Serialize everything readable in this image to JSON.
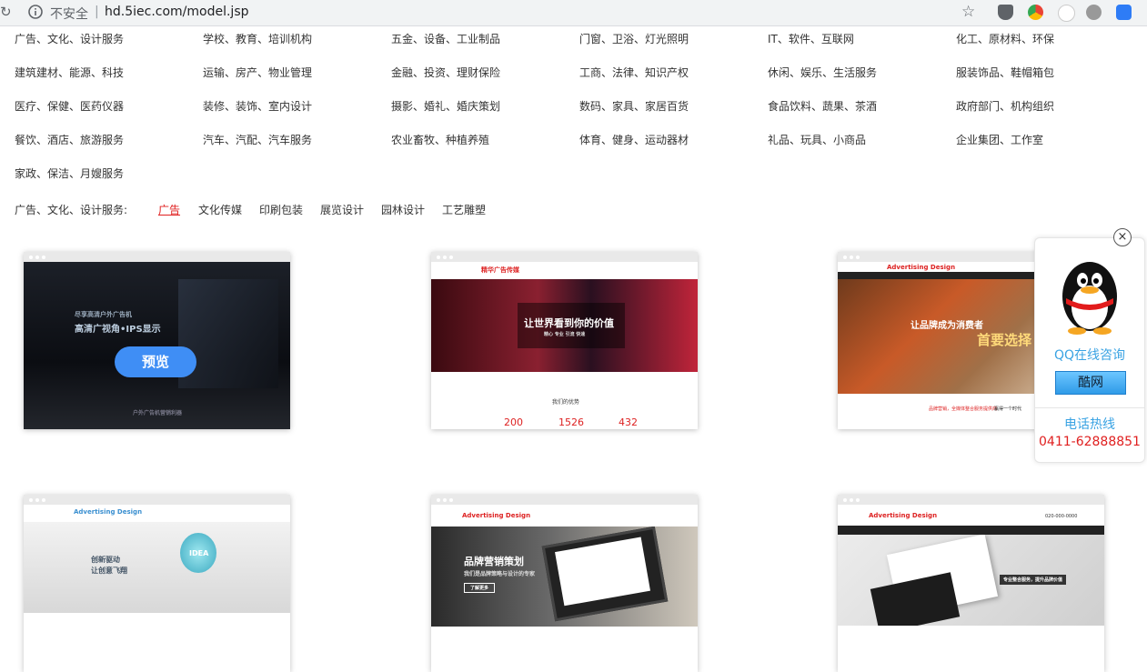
{
  "browser": {
    "insecure_label": "不安全",
    "separator": "|",
    "url": "hd.5iec.com/model.jsp"
  },
  "categories": [
    [
      "广告、文化、设计服务",
      "学校、教育、培训机构",
      "五金、设备、工业制品",
      "门窗、卫浴、灯光照明",
      "IT、软件、互联网",
      "化工、原材料、环保"
    ],
    [
      "建筑建材、能源、科技",
      "运输、房产、物业管理",
      "金融、投资、理财保险",
      "工商、法律、知识产权",
      "休闲、娱乐、生活服务",
      "服装饰品、鞋帽箱包"
    ],
    [
      "医疗、保健、医药仪器",
      "装修、装饰、室内设计",
      "摄影、婚礼、婚庆策划",
      "数码、家具、家居百货",
      "食品饮料、蔬果、茶酒",
      "政府部门、机构组织"
    ],
    [
      "餐饮、酒店、旅游服务",
      "汽车、汽配、汽车服务",
      "农业畜牧、种植养殖",
      "体育、健身、运动器材",
      "礼品、玩具、小商品",
      "企业集团、工作室"
    ],
    [
      "家政、保洁、月嫂服务"
    ]
  ],
  "filter": {
    "label": "广告、文化、设计服务:",
    "options": [
      "广告",
      "文化传媒",
      "印刷包装",
      "展览设计",
      "园林设计",
      "工艺雕塑"
    ],
    "active_index": 0
  },
  "templates": {
    "t1": {
      "hero_line1": "尽享高清户外广告机",
      "hero_line2": "高清广视角•IPS显示",
      "preview_label": "预览",
      "footer": "户外广告机营销利器"
    },
    "t2": {
      "brand": "精华广告传媒",
      "hero": "让世界看到你的价值",
      "sub": "精心 专业 引流 快速",
      "section": "我们的优势",
      "stats": [
        "200",
        "1526",
        "432"
      ]
    },
    "t3": {
      "brand": "Advertising Design",
      "hero": "让品牌成为消费者",
      "accent": "首要选择",
      "tagline_red": "品牌营销，全媒体整合服务提供商",
      "tagline_dark": "赢得一个时代"
    },
    "t4": {
      "brand": "Advertising Design",
      "hero_line1": "创新驱动",
      "hero_line2": "让创意飞翔",
      "bulb_text": "IDEA"
    },
    "t5": {
      "brand": "Advertising Design",
      "hero": "品牌营销策划",
      "sub": "我们是品牌策略与设计的专家",
      "more": "了解更多"
    },
    "t6": {
      "brand": "Advertising Design",
      "phone": "020-000-0000",
      "hero": "专业整合服务，提升品牌价值"
    }
  },
  "qq_widget": {
    "close": "×",
    "consult": "QQ在线咨询",
    "button": "酷网",
    "hotline_label": "电话热线",
    "phone": "0411-62888851"
  },
  "colors": {
    "accent_red": "#e02020",
    "qq_blue": "#3aa3e3",
    "preview_blue": "#3f8ef5"
  }
}
